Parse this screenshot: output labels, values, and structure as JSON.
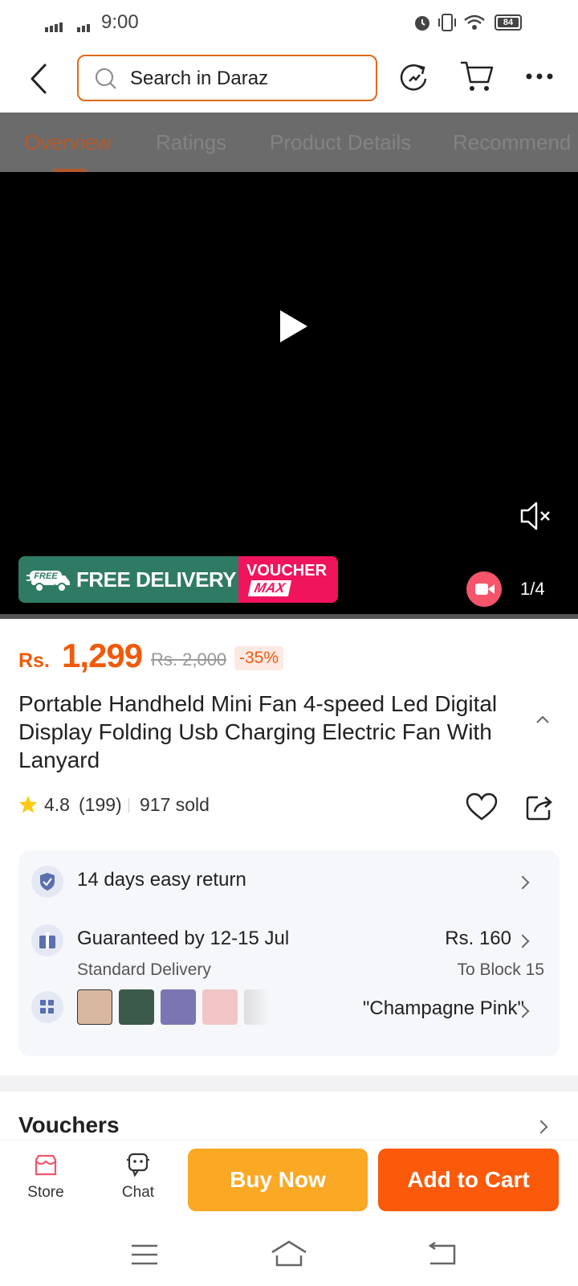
{
  "status_bar": {
    "time": "9:00",
    "battery": "84"
  },
  "top_bar": {
    "search_placeholder": "Search in Daraz"
  },
  "tabs": [
    {
      "label": "Overview",
      "active": true
    },
    {
      "label": "Ratings",
      "active": false
    },
    {
      "label": "Product Details",
      "active": false
    },
    {
      "label": "Recommend",
      "active": false
    }
  ],
  "media": {
    "promo_free_badge": "FREE",
    "promo_free_label": "FREE DELIVERY",
    "promo_voucher_line1": "VOUCHER",
    "promo_voucher_line2": "MAX",
    "counter": "1/4"
  },
  "product": {
    "price_prefix": "Rs.",
    "price": "1,299",
    "original_price": "Rs. 2,000",
    "discount": "-35%",
    "title": "Portable Handheld Mini Fan 4-speed Led Digital Display Folding Usb Charging Electric Fan With Lanyard",
    "rating": "4.8",
    "rating_count": "(199)",
    "sold": "917 sold"
  },
  "info": {
    "returns": "14 days easy return",
    "delivery_title": "Guaranteed by 12-15 Jul",
    "delivery_type": "Standard Delivery",
    "delivery_price": "Rs. 160",
    "delivery_dest": "To Block 15",
    "variant_selected": "\"Champagne Pink\""
  },
  "sections": {
    "vouchers": "Vouchers"
  },
  "bottom_bar": {
    "store": "Store",
    "chat": "Chat",
    "buy_now": "Buy Now",
    "add_to_cart": "Add to Cart"
  },
  "colors": {
    "brand_orange": "#f05a0a",
    "buy_now": "#fba824",
    "add_to_cart": "#fa5a0a",
    "free_delivery": "#2f7a64",
    "voucher_pink": "#f0145c"
  }
}
